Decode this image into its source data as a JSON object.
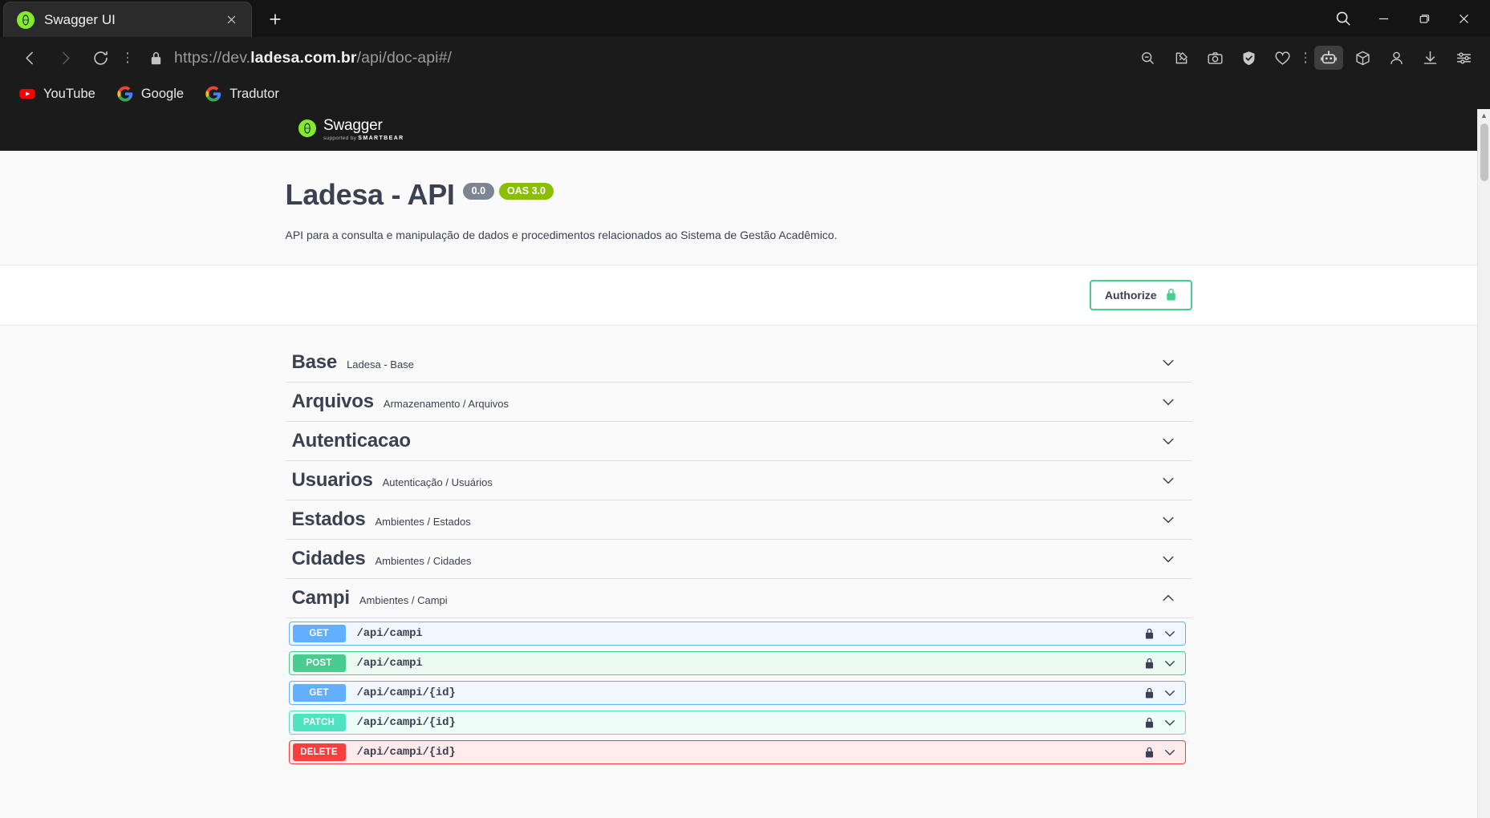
{
  "browser": {
    "tab": {
      "title": "Swagger UI",
      "favicon_icon": "swagger-favicon",
      "close_icon": "close-icon"
    },
    "new_tab_label": "+",
    "window_controls": [
      {
        "name": "window-search",
        "icon": "search-icon",
        "label": ""
      },
      {
        "name": "window-minimize",
        "icon": "minimize-icon",
        "label": ""
      },
      {
        "name": "window-maximize",
        "icon": "maximize-icon",
        "label": ""
      },
      {
        "name": "window-close",
        "icon": "close-icon",
        "label": ""
      }
    ],
    "nav": {
      "back_icon": "back-arrow-icon",
      "forward_icon": "forward-arrow-icon",
      "reload_icon": "reload-icon",
      "menu_dots_icon": "vertical-dots-icon",
      "lock_icon": "padlock-icon",
      "url_prefix": "https://dev.",
      "url_domain": "ladesa.com.br",
      "url_suffix": "/api/doc-api#/",
      "url_full": "https://dev.ladesa.com.br/api/doc-api#/"
    },
    "toolbar_icons": [
      {
        "name": "zoom-out-icon",
        "label": ""
      },
      {
        "name": "edit-pin-icon",
        "label": ""
      },
      {
        "name": "camera-icon",
        "label": ""
      },
      {
        "name": "shield-check-icon",
        "label": ""
      },
      {
        "name": "heart-icon",
        "label": ""
      },
      {
        "name": "vertical-dots-icon",
        "label": ""
      },
      {
        "name": "robot-icon",
        "label": ""
      },
      {
        "name": "cube-icon",
        "label": ""
      },
      {
        "name": "profile-icon",
        "label": ""
      },
      {
        "name": "download-icon",
        "label": ""
      },
      {
        "name": "settings-sliders-icon",
        "label": ""
      }
    ],
    "bookmarks": [
      {
        "label": "YouTube",
        "icon": "youtube-icon"
      },
      {
        "label": "Google",
        "icon": "google-icon"
      },
      {
        "label": "Tradutor",
        "icon": "google-icon"
      }
    ]
  },
  "swagger": {
    "brand": {
      "word": "Swagger",
      "supported_by": "supported by",
      "company": "SMARTBEAR"
    },
    "info": {
      "title": "Ladesa - API",
      "version_badge": "0.0",
      "oas_badge": "OAS 3.0",
      "description": "API para a consulta e manipulação de dados e procedimentos relacionados ao Sistema de Gestão Acadêmico."
    },
    "authorize": {
      "label": "Authorize",
      "lock_icon": "padlock-icon"
    },
    "tags": [
      {
        "name": "Base",
        "description": "Ladesa - Base",
        "expanded": false,
        "operations": []
      },
      {
        "name": "Arquivos",
        "description": "Armazenamento / Arquivos",
        "expanded": false,
        "operations": []
      },
      {
        "name": "Autenticacao",
        "description": "",
        "expanded": false,
        "operations": []
      },
      {
        "name": "Usuarios",
        "description": "Autenticação / Usuários",
        "expanded": false,
        "operations": []
      },
      {
        "name": "Estados",
        "description": "Ambientes / Estados",
        "expanded": false,
        "operations": []
      },
      {
        "name": "Cidades",
        "description": "Ambientes / Cidades",
        "expanded": false,
        "operations": []
      },
      {
        "name": "Campi",
        "description": "Ambientes / Campi",
        "expanded": true,
        "operations": [
          {
            "method": "GET",
            "path": "/api/campi",
            "locked": true
          },
          {
            "method": "POST",
            "path": "/api/campi",
            "locked": true
          },
          {
            "method": "GET",
            "path": "/api/campi/{id}",
            "locked": true
          },
          {
            "method": "PATCH",
            "path": "/api/campi/{id}",
            "locked": true
          },
          {
            "method": "DELETE",
            "path": "/api/campi/{id}",
            "locked": true
          }
        ]
      }
    ]
  },
  "colors": {
    "get": "#61affe",
    "post": "#49cc90",
    "patch": "#50e3c2",
    "delete": "#f93e3e",
    "swagger_green": "#85ea2d",
    "oas_green": "#89bf04",
    "version_gray": "#7d8492",
    "text": "#3b4151"
  }
}
